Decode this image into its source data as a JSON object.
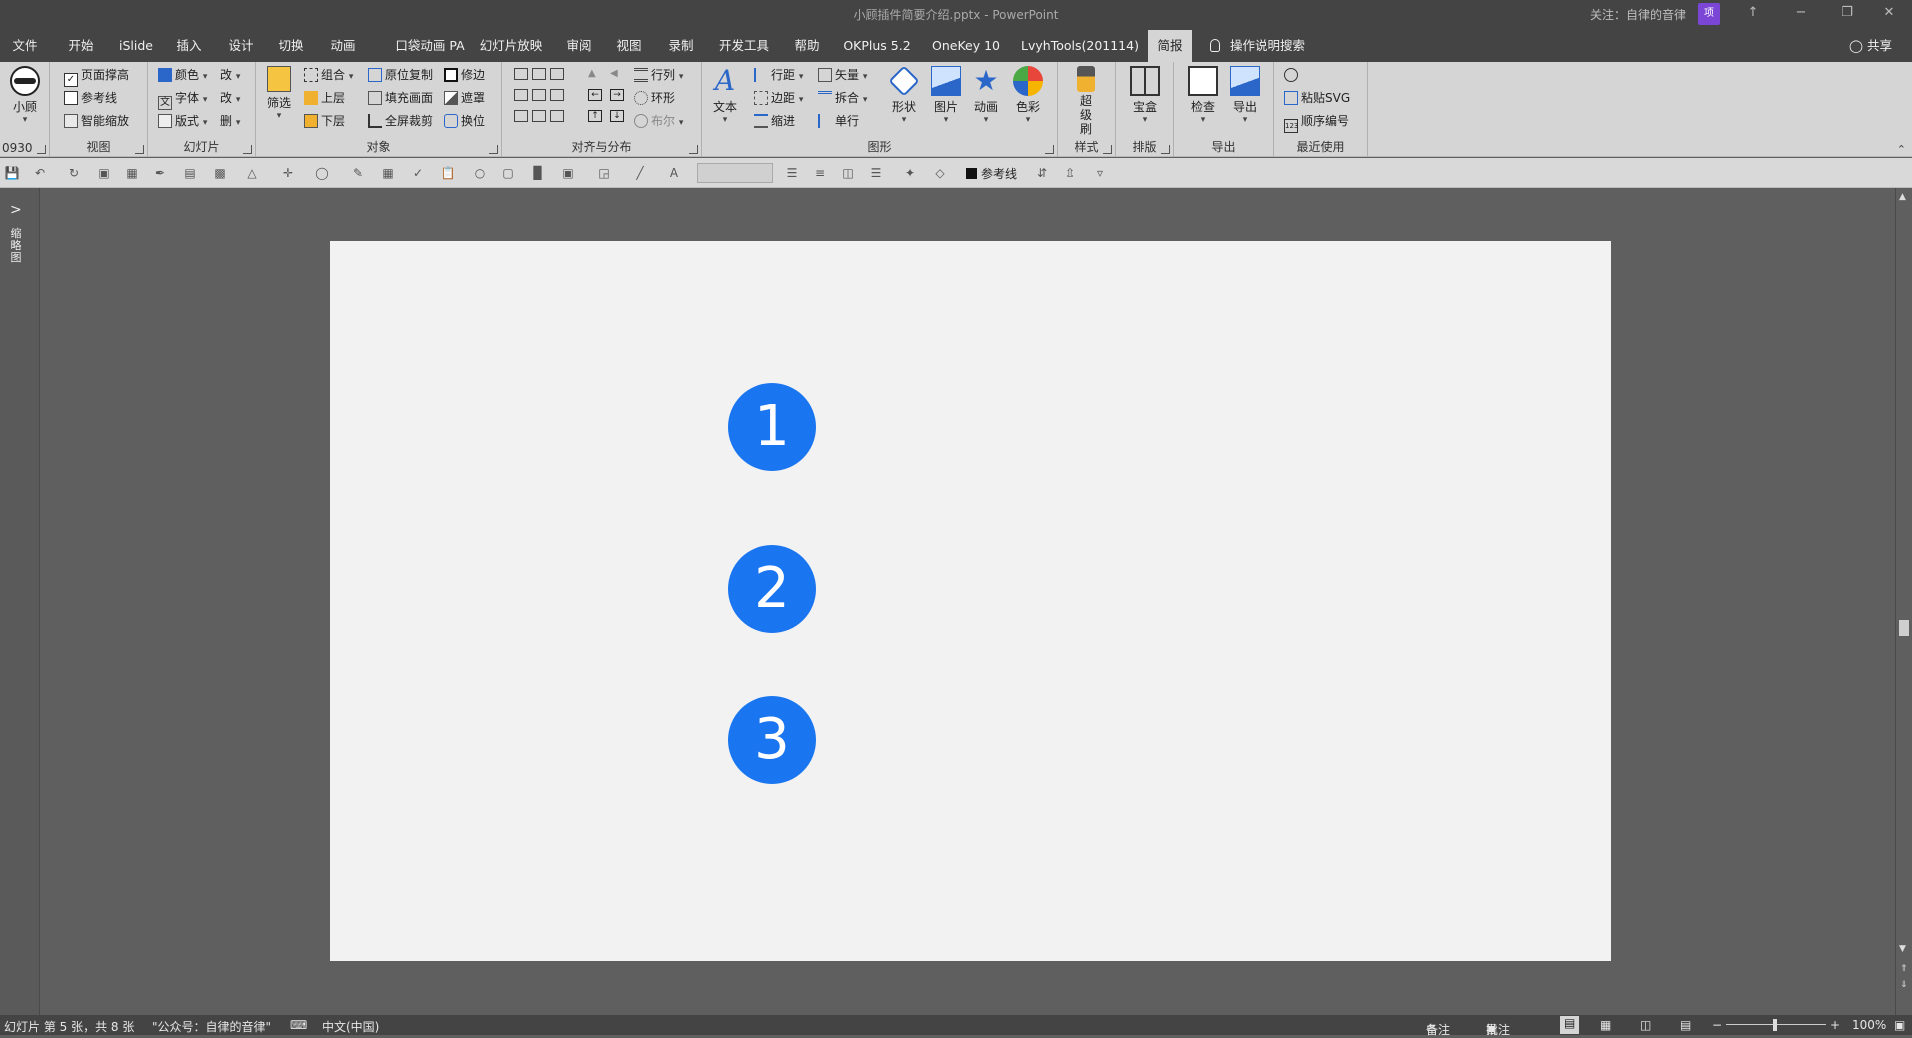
{
  "window": {
    "title": "小顾插件简要介绍.pptx  -  PowerPoint",
    "follow_text": "关注：自律的音律",
    "avatar_text": "项",
    "controls": [
      "↑",
      "−",
      "❐",
      "✕"
    ]
  },
  "menu": {
    "tabs": [
      "文件",
      "开始",
      "iSlide",
      "插入",
      "设计",
      "切换",
      "动画",
      "口袋动画 PA",
      "幻灯片放映",
      "审阅",
      "视图",
      "录制",
      "开发工具",
      "帮助",
      "OKPlus 5.2",
      "OneKey 10",
      "LvyhTools(201114)",
      "简报"
    ],
    "active_tab": "简报",
    "tell_me": "操作说明搜索",
    "share": "共享"
  },
  "ribbon": {
    "groups": {
      "g0930": {
        "label": "0930",
        "big": "小顾"
      },
      "view": {
        "label": "视图",
        "items": [
          "页面撑高",
          "参考线",
          "智能缩放"
        ]
      },
      "slide": {
        "label": "幻灯片",
        "items": [
          "颜色",
          "字体",
          "版式"
        ],
        "items2": [
          "改",
          "改",
          "删"
        ]
      },
      "object": {
        "label": "对象",
        "big": "筛选",
        "items": [
          "组合",
          "上层",
          "下层",
          "原位复制",
          "填充画面",
          "全屏裁剪",
          "修边",
          "遮罩",
          "换位"
        ]
      },
      "align": {
        "label": "对齐与分布",
        "items": [
          "行列",
          "环形",
          "布尔"
        ]
      },
      "graphics": {
        "label": "图形",
        "items": [
          "行距",
          "边距",
          "缩进",
          "矢量",
          "拆合",
          "单行"
        ],
        "bigs": [
          "文本",
          "形状",
          "图片",
          "动画",
          "色彩"
        ]
      },
      "style": {
        "label": "样式",
        "big": "超级刷"
      },
      "layout": {
        "label": "排版",
        "big": "宝盒"
      },
      "export": {
        "label": "导出",
        "bigs": [
          "检查",
          "导出"
        ]
      },
      "recent": {
        "label": "最近使用",
        "items": [
          "粘贴SVG",
          "顺序编号"
        ]
      }
    }
  },
  "qat": {
    "guides_label": "参考线"
  },
  "left_panel": {
    "arrow": ">",
    "label": "缩略图"
  },
  "slide": {
    "circles": [
      "1",
      "2",
      "3"
    ],
    "circle_color": "#1a75f0",
    "background": "#f2f2f2"
  },
  "status": {
    "slide_info": "幻灯片 第 5 张，共 8 张",
    "theme": "\"公众号：自律的音律\"",
    "language": "中文(中国)",
    "notes": "备注",
    "comments": "批注",
    "zoom": "100%"
  }
}
